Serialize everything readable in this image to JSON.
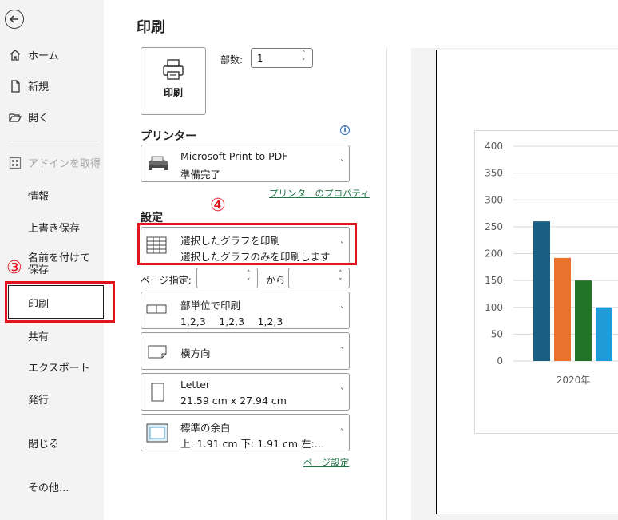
{
  "sidebar": {
    "home": "ホーム",
    "new": "新規",
    "open": "開く",
    "get_addins": "アドインを取得",
    "info": "情報",
    "save": "上書き保存",
    "save_as": "名前を付けて保存",
    "print": "印刷",
    "share": "共有",
    "export": "エクスポート",
    "publish": "発行",
    "close": "閉じる",
    "more": "その他..."
  },
  "annotations": {
    "step3": "③",
    "step4": "④",
    "highlight_color": "#e3141c"
  },
  "main": {
    "title": "印刷",
    "print_button": "印刷",
    "copies_label": "部数:",
    "copies_value": "1",
    "printer_heading": "プリンター",
    "printer_name": "Microsoft Print to PDF",
    "printer_status": "準備完了",
    "printer_properties": "プリンターのプロパティ",
    "settings_heading": "設定",
    "scope_title": "選択したグラフを印刷",
    "scope_desc": "選択したグラフのみを印刷します",
    "pages_label": "ページ指定:",
    "pages_to": "から",
    "collate_title": "部単位で印刷",
    "collate_desc": "1,2,3　 1,2,3　 1,2,3",
    "orientation": "横方向",
    "paper_title": "Letter",
    "paper_desc": "21.59 cm x 27.94 cm",
    "margins_title": "標準の余白",
    "margins_desc": "上: 1.91 cm 下: 1.91 cm 左:…",
    "page_setup": "ページ設定"
  },
  "chart_data": {
    "type": "bar",
    "categories": [
      "2020年"
    ],
    "series": [
      {
        "values": [
          260
        ],
        "color": "#1a5f82"
      },
      {
        "values": [
          192
        ],
        "color": "#e9722f"
      },
      {
        "values": [
          150
        ],
        "color": "#217326"
      },
      {
        "values": [
          100
        ],
        "color": "#1f9bd7"
      }
    ],
    "yticks": [
      "0",
      "50",
      "100",
      "150",
      "200",
      "250",
      "300",
      "350",
      "400"
    ],
    "ylim": [
      0,
      400
    ],
    "grid": true
  }
}
